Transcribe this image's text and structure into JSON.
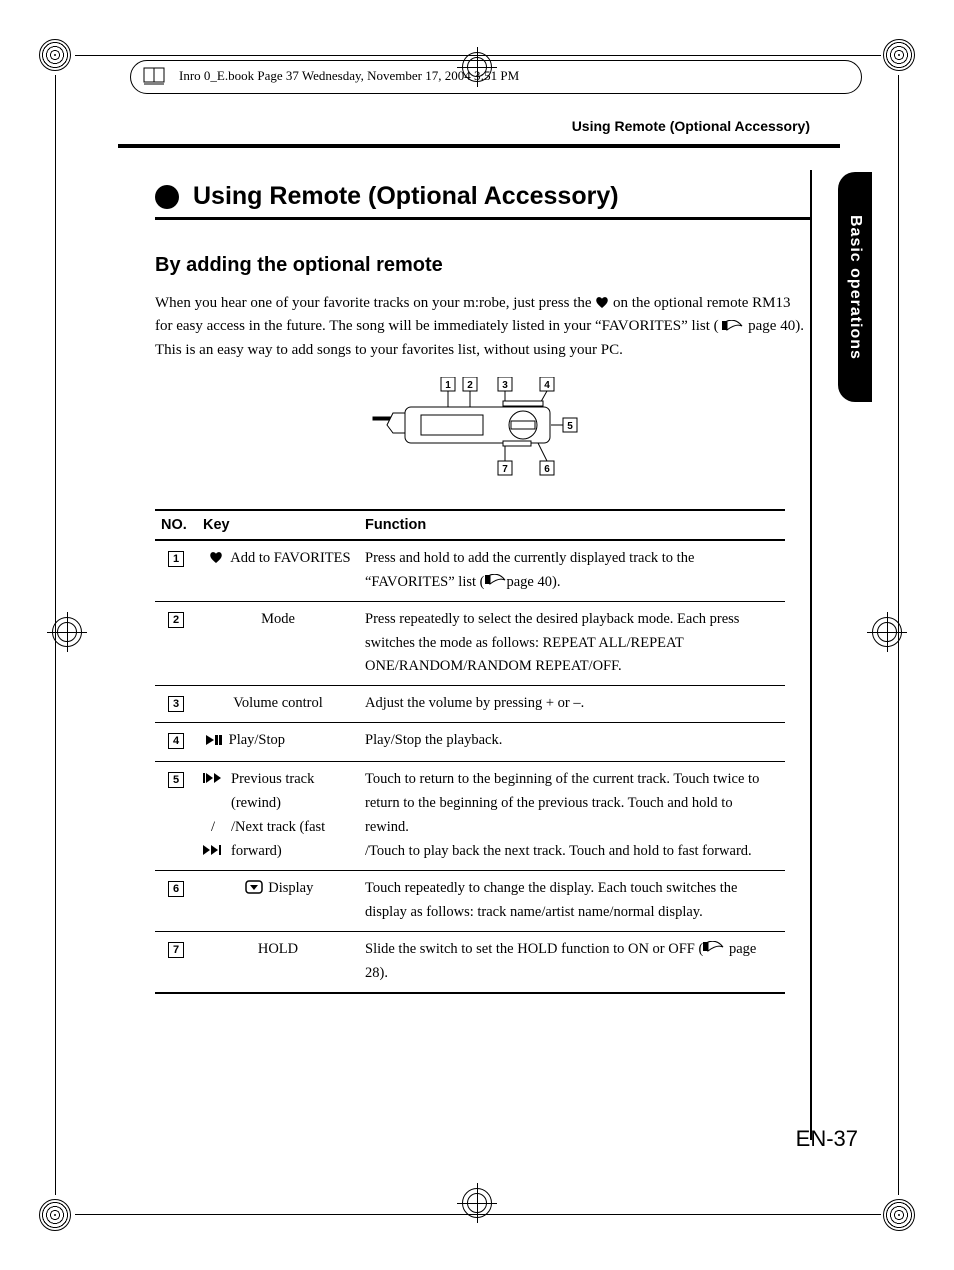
{
  "fm_header": "Inro 0_E.book  Page 37  Wednesday, November 17, 2004  3:51 PM",
  "running_head": "Using Remote (Optional Accessory)",
  "tab_label": "Basic operations",
  "h1": "Using Remote (Optional Accessory)",
  "h2": "By adding the optional remote",
  "para_a": "When you hear one of your favorite tracks on your m:robe, just press the ",
  "para_b": " on the optional remote RM13 for easy access in the future. The song will be immediately listed in your “FAVORITES” list (",
  "para_c": "page 40). This is an easy way to add songs to your favorites list, without using your PC.",
  "illus_labels": [
    "1",
    "2",
    "3",
    "4",
    "5",
    "6",
    "7"
  ],
  "table": {
    "head_no": "NO.",
    "head_key": "Key",
    "head_fn": "Function",
    "rows": [
      {
        "no": "1",
        "icons": [
          "heart"
        ],
        "key": "Add to FAVORITES",
        "fn": "Press and hold to add the currently displayed track to the “FAVORITES” list (",
        "fn_ref": "page 40).",
        "center_key": true
      },
      {
        "no": "2",
        "icons": [],
        "key": "Mode",
        "fn": "Press repeatedly to select the desired playback mode. Each press switches the mode as follows: REPEAT ALL/REPEAT ONE/RANDOM/RANDOM REPEAT/OFF.",
        "center_key": true
      },
      {
        "no": "3",
        "icons": [],
        "key": "Volume control",
        "fn": "Adjust the volume by pressing + or –.",
        "center_key": true
      },
      {
        "no": "4",
        "icons": [
          "playpause"
        ],
        "key": "Play/Stop",
        "fn": "Play/Stop the playback."
      },
      {
        "no": "5",
        "icons": [
          "prev",
          "next"
        ],
        "key": "Previous track (rewind)\n/Next track (fast forward)",
        "fn": "Touch to return to the beginning of the current track. Touch twice to return to the beginning of the previous track. Touch and hold to rewind.\n/Touch to play back the next track. Touch and hold to fast forward."
      },
      {
        "no": "6",
        "icons": [
          "display"
        ],
        "key": "Display",
        "fn": "Touch repeatedly to change the display. Each touch switches the display as follows: track name/artist name/normal display.",
        "center_key": true
      },
      {
        "no": "7",
        "icons": [],
        "key": "HOLD",
        "fn": "Slide the switch to set the HOLD function to ON or OFF (",
        "fn_ref": " page 28).",
        "center_key": true
      }
    ]
  },
  "footer": "EN-37"
}
